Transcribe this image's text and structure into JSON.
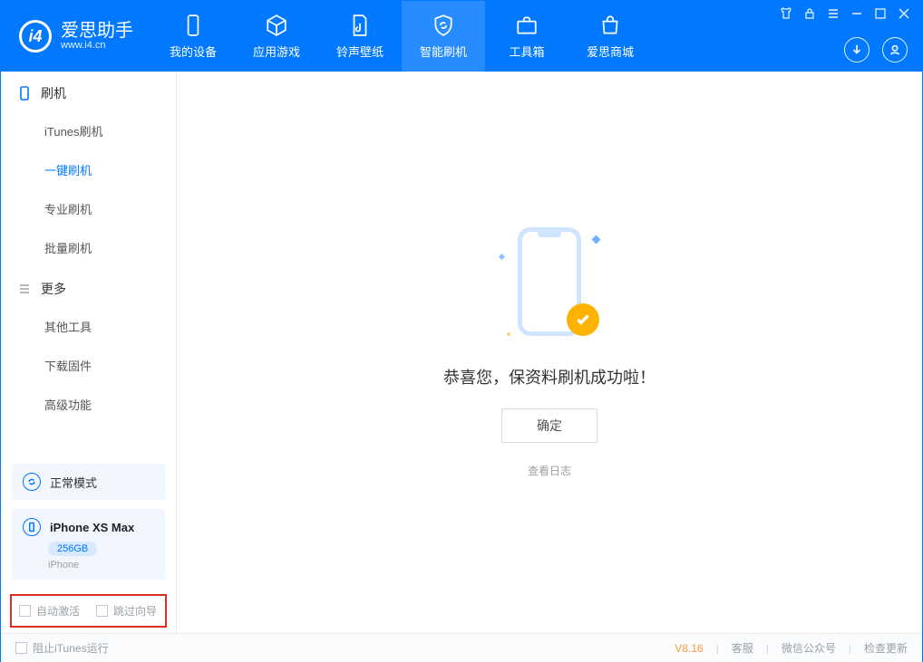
{
  "brand": {
    "cn": "爱思助手",
    "en": "www.i4.cn"
  },
  "nav": {
    "device": "我的设备",
    "apps": "应用游戏",
    "ring": "铃声壁纸",
    "flash": "智能刷机",
    "toolbox": "工具箱",
    "mall": "爱思商城"
  },
  "sidebar": {
    "group_flash": "刷机",
    "group_more": "更多",
    "items": {
      "itunes": "iTunes刷机",
      "onekey": "一键刷机",
      "pro": "专业刷机",
      "batch": "批量刷机",
      "other": "其他工具",
      "firmware": "下载固件",
      "advanced": "高级功能"
    }
  },
  "mode_card": {
    "label": "正常模式"
  },
  "device_card": {
    "name": "iPhone XS Max",
    "storage": "256GB",
    "sub": "iPhone"
  },
  "checkboxes": {
    "auto_activate": "自动激活",
    "skip_guide": "跳过向导"
  },
  "main": {
    "success": "恭喜您，保资料刷机成功啦！",
    "ok": "确定",
    "view_log": "查看日志"
  },
  "footer": {
    "block_itunes": "阻止iTunes运行",
    "version": "V8.16",
    "cs": "客服",
    "wechat": "微信公众号",
    "update": "检查更新"
  }
}
